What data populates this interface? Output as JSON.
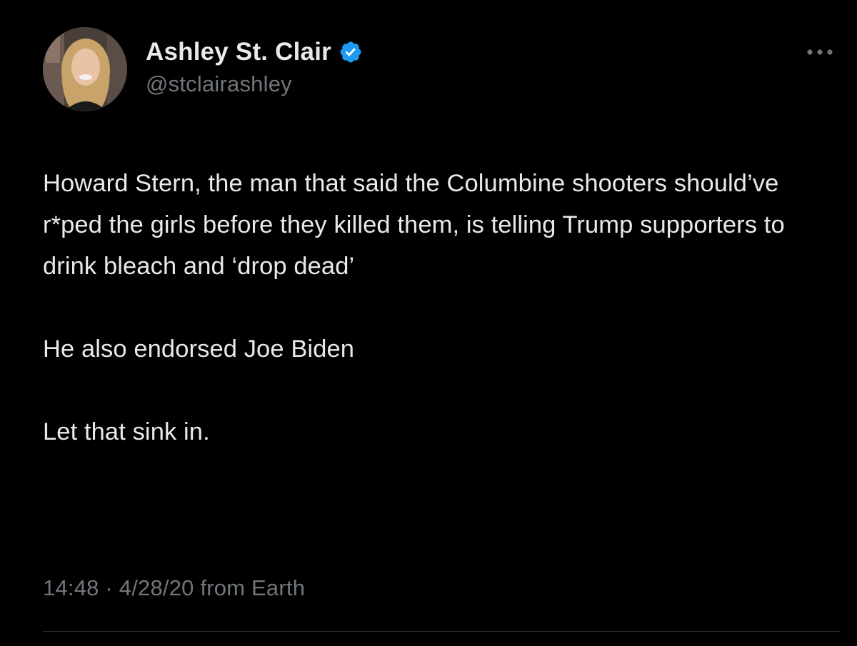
{
  "author": {
    "display_name": "Ashley St. Clair",
    "handle": "@stclairashley",
    "verified": true,
    "verified_color": "#1d9bf0"
  },
  "icons": {
    "verified": "verified-badge-icon",
    "more": "more-options-icon"
  },
  "tweet": {
    "paragraphs": [
      "Howard Stern, the man that said the Columbine shooters should’ve r*ped the girls before they killed them, is telling Trump supporters to drink bleach and ‘drop dead’",
      "He also endorsed Joe Biden",
      "Let that sink in."
    ],
    "time": "14:48",
    "separator": "·",
    "date": "4/28/20",
    "source": "from Earth"
  },
  "colors": {
    "background": "#000000",
    "primary_text": "#e7e9ea",
    "secondary_text": "#71767b",
    "divider": "#2f3336"
  }
}
